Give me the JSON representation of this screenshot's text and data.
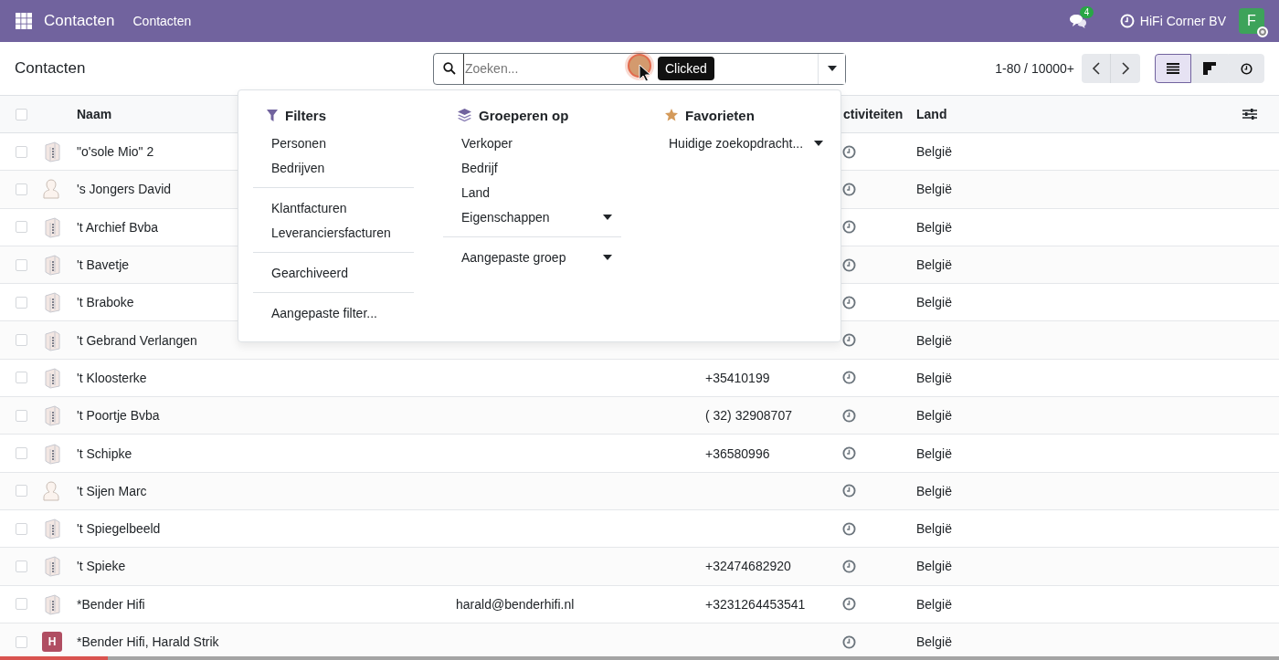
{
  "navbar": {
    "app_name": "Contacten",
    "menu": [
      {
        "label": "Contacten"
      }
    ],
    "messages_badge": "4",
    "company": "HiFi Corner BV",
    "user_initial": "F"
  },
  "control_panel": {
    "title": "Contacten",
    "search": {
      "placeholder": "Zoeken..."
    },
    "pager": "1-80 / 10000+",
    "views": [
      {
        "kind": "list",
        "selected": true
      },
      {
        "kind": "kanban",
        "selected": false
      },
      {
        "kind": "activity",
        "selected": false
      }
    ]
  },
  "table": {
    "select_all_checked": false,
    "columns": [
      {
        "label": "Naam"
      },
      {
        "label": "ctiviteiten"
      },
      {
        "label": "Land"
      }
    ],
    "rows": [
      {
        "kind": "company",
        "checked": false,
        "name": "\"o'sole Mio\" 2",
        "email": "",
        "phone": "",
        "country": "België"
      },
      {
        "kind": "person",
        "checked": false,
        "name": "'s Jongers David",
        "email": "",
        "phone": "",
        "country": "België"
      },
      {
        "kind": "company",
        "checked": false,
        "name": "'t Archief Bvba",
        "email": "",
        "phone": "",
        "country": "België"
      },
      {
        "kind": "company",
        "checked": false,
        "name": "'t Bavetje",
        "email": "",
        "phone": "",
        "country": "België"
      },
      {
        "kind": "company",
        "checked": false,
        "name": "'t Braboke",
        "email": "",
        "phone": "",
        "country": "België"
      },
      {
        "kind": "company",
        "checked": false,
        "name": "'t Gebrand Verlangen",
        "email": "",
        "phone": "",
        "country": "België"
      },
      {
        "kind": "company",
        "checked": false,
        "name": "'t Kloosterke",
        "email": "",
        "phone": "+35410199",
        "country": "België"
      },
      {
        "kind": "company",
        "checked": false,
        "name": "'t Poortje Bvba",
        "email": "",
        "phone": "( 32) 32908707",
        "country": "België"
      },
      {
        "kind": "company",
        "checked": false,
        "name": "'t Schipke",
        "email": "",
        "phone": "+36580996",
        "country": "België"
      },
      {
        "kind": "person",
        "checked": false,
        "name": "'t Sijen Marc",
        "email": "",
        "phone": "",
        "country": "België"
      },
      {
        "kind": "company",
        "checked": false,
        "name": "'t Spiegelbeeld",
        "email": "",
        "phone": "",
        "country": "België"
      },
      {
        "kind": "company",
        "checked": false,
        "name": "'t Spieke",
        "email": "",
        "phone": "+32474682920",
        "country": "België"
      },
      {
        "kind": "company",
        "checked": false,
        "name": "*Bender Hifi",
        "email": "harald@benderhifi.nl",
        "phone": "+3231264453541",
        "country": "België"
      },
      {
        "kind": "initial",
        "checked": false,
        "initial": "H",
        "color": "#b04e62",
        "name": "*Bender Hifi, Harald Strik",
        "email": "",
        "phone": "",
        "country": "België"
      }
    ]
  },
  "search_panel": {
    "filters": {
      "title": "Filters",
      "groups": [
        [
          "Personen",
          "Bedrijven"
        ],
        [
          "Klantfacturen",
          "Leveranciersfacturen"
        ],
        [
          "Gearchiveerd"
        ],
        [
          "Aangepaste filter..."
        ]
      ]
    },
    "group_by": {
      "title": "Groeperen op",
      "groups": [
        [
          {
            "label": "Verkoper",
            "has_caret": false
          },
          {
            "label": "Bedrijf",
            "has_caret": false
          },
          {
            "label": "Land",
            "has_caret": false
          },
          {
            "label": "Eigenschappen",
            "has_caret": true
          }
        ],
        [
          {
            "label": "Aangepaste groep",
            "has_caret": true
          }
        ]
      ]
    },
    "favorites": {
      "title": "Favorieten",
      "items": [
        {
          "label": "Huidige zoekopdracht...",
          "has_caret": true
        }
      ]
    }
  },
  "tooltip": "Clicked",
  "loading_bar": {
    "level": 0.084
  }
}
